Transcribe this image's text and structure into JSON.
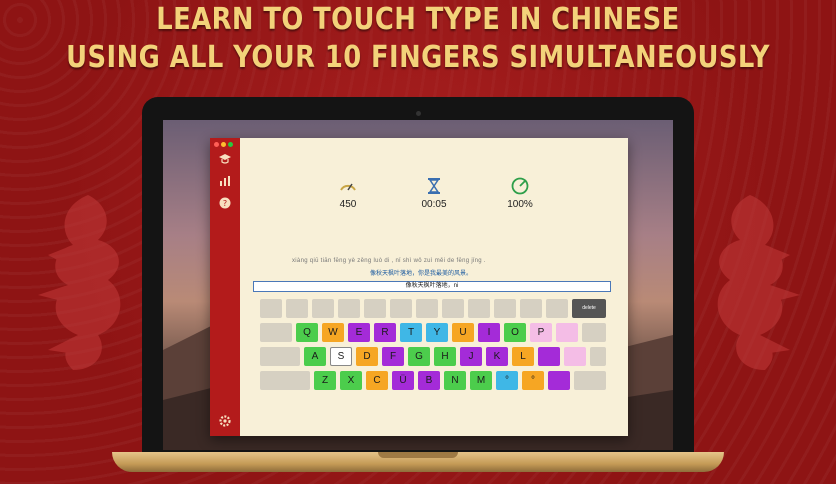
{
  "headline": {
    "line1": "LEARN TO TOUCH TYPE IN CHINESE",
    "line2": "USING ALL YOUR 10 FINGERS SIMULTANEOUSLY"
  },
  "app": {
    "sidebar_icons": [
      "graduation-cap-icon",
      "bar-chart-icon",
      "help-icon",
      "settings-icon"
    ],
    "stats": {
      "speed": "450",
      "time": "00:05",
      "accuracy": "100%"
    },
    "pinyin_text": "xiàng qiū tiān fēng yè zěng luò di ,   nǐ shì wǒ zuì měi de fēng jǐng .",
    "target_text": "像秋天枫叶落地，你是我最美的风景。",
    "input_text": "像秋天枫叶落地，ni"
  },
  "keyboard": {
    "row0_last": "delete",
    "row1": [
      "Q",
      "W",
      "E",
      "R",
      "T",
      "Y",
      "U",
      "I",
      "O",
      "P",
      "",
      ""
    ],
    "row2": [
      "A",
      "S",
      "D",
      "F",
      "G",
      "H",
      "J",
      "K",
      "L",
      "",
      ""
    ],
    "row3": [
      "Z",
      "X",
      "C",
      "Ü",
      "B",
      "N",
      "M",
      "°",
      "°",
      ""
    ]
  },
  "colors": {
    "green": "#4ccd4c",
    "purple": "#a42bd8",
    "orange": "#f6a623",
    "blue": "#3fb7e6",
    "pink": "#f4bde6",
    "key": "#d6d0c2",
    "accent": "#b31b1b",
    "headline": "#f3d27a"
  }
}
